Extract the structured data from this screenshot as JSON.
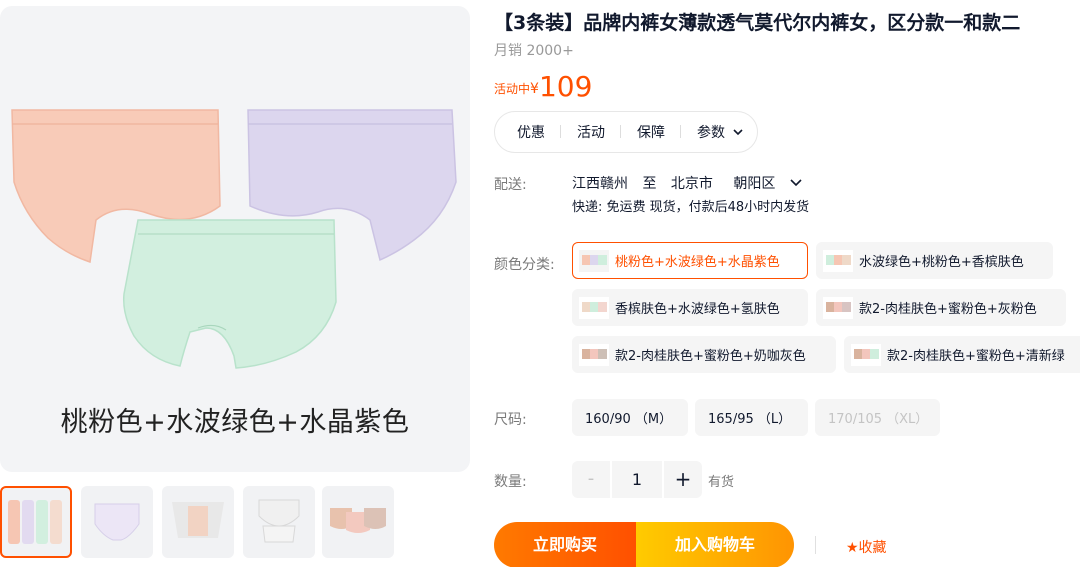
{
  "gallery": {
    "main_caption": "桃粉色+水波绿色+水晶紫色",
    "thumbnails": [
      "thumb-1",
      "thumb-2",
      "thumb-3",
      "thumb-4",
      "thumb-5"
    ],
    "swatch_colors": {
      "pink": "#f8cbb8",
      "purple": "#dcd6ee",
      "green": "#cfeedd"
    }
  },
  "product": {
    "title": "【3条装】品牌内裤女薄款透气莫代尔内裤女，区分款一和款二",
    "sales": "月销 2000+",
    "price_tag": "活动中",
    "currency": "¥",
    "price": "109",
    "accent_color": "#ff5000"
  },
  "tabs": {
    "promo": "优惠",
    "activity": "活动",
    "guarantee": "保障",
    "params": "参数"
  },
  "shipping": {
    "label": "配送:",
    "from": "江西赣州",
    "to_word": "至",
    "city": "北京市",
    "district": "朝阳区",
    "info": "快递: 免运费  现货，付款后48小时内发货"
  },
  "color": {
    "label": "颜色分类:",
    "options": [
      "桃粉色+水波绿色+水晶紫色",
      "水波绿色+桃粉色+香槟肤色",
      "香槟肤色+水波绿色+氢肤色",
      "款2-肉桂肤色+蜜粉色+灰粉色",
      "款2-肉桂肤色+蜜粉色+奶咖灰色",
      "款2-肉桂肤色+蜜粉色+清新绿"
    ],
    "selected": "桃粉色+水波绿色+水晶紫色"
  },
  "size": {
    "label": "尺码:",
    "options": [
      "160/90 （M）",
      "165/95 （L）",
      "170/105 （XL）"
    ]
  },
  "quantity": {
    "label": "数量:",
    "minus": "-",
    "value": "1",
    "plus": "+",
    "stock": "有货"
  },
  "actions": {
    "buy_now": "立即购买",
    "add_cart": "加入购物车",
    "favorite": "★收藏"
  }
}
